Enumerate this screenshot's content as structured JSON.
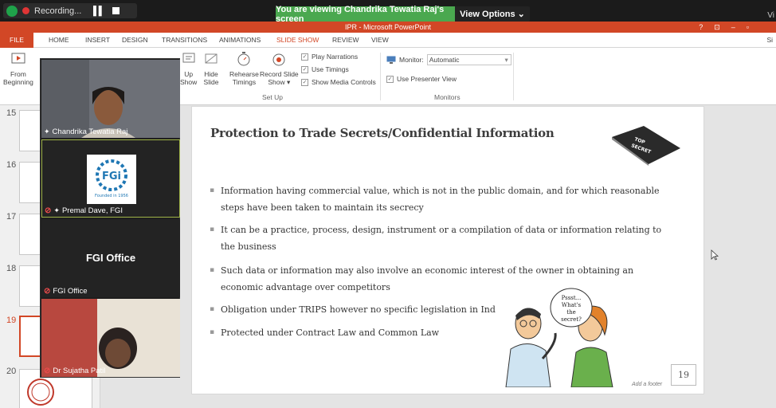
{
  "zoom": {
    "recording_label": "Recording...",
    "viewing_banner": "You are viewing Chandrika Tewatia Raj's screen",
    "view_options": "View Options ⌄",
    "top_right": "Vi"
  },
  "window": {
    "title": "IPR - Microsoft PowerPoint",
    "help": "?",
    "controls": [
      "?",
      "⊡",
      "–",
      "▫"
    ]
  },
  "ribbon_tabs": [
    "FILE",
    "HOME",
    "INSERT",
    "DESIGN",
    "TRANSITIONS",
    "ANIMATIONS",
    "SLIDE SHOW",
    "REVIEW",
    "VIEW"
  ],
  "active_tab": "SLIDE SHOW",
  "sign_in": "Si",
  "ribbon": {
    "from_beginning": [
      "From",
      "Beginning"
    ],
    "set_up_show": [
      "Up",
      "Show"
    ],
    "hide_slide": [
      "Hide",
      "Slide"
    ],
    "rehearse_timings": [
      "Rehearse",
      "Timings"
    ],
    "record_slide_show": [
      "Record Slide",
      "Show ▾"
    ],
    "play_narrations": "Play Narrations",
    "use_timings": "Use Timings",
    "show_media_controls": "Show Media Controls",
    "setup_group": "Set Up",
    "monitor_label": "Monitor:",
    "monitor_value": "Automatic",
    "use_presenter_view": "Use Presenter View",
    "monitors_group": "Monitors"
  },
  "thumbnails": {
    "numbers": [
      "15",
      "16",
      "17",
      "18",
      "19",
      "20"
    ],
    "selected": "19"
  },
  "slide": {
    "title": "Protection to Trade Secrets/Confidential Information",
    "bullets": [
      "Information having commercial value, which is not in the public domain, and for which reasonable steps have been taken to maintain its secrecy",
      "It can be a practice, process, design, instrument or a compilation of data or information relating to the business",
      "Such data or information may also involve an economic interest of the owner in obtaining an economic advantage over competitors",
      "Obligation under TRIPS however no specific legislation in Ind",
      "Protected under Contract Law and Common Law"
    ],
    "book_text": [
      "TOP",
      "SECRET"
    ],
    "speech_bubble": [
      "Pssst...",
      "What's",
      "the",
      "secret?"
    ],
    "footer": "Add a footer",
    "page_number": "19"
  },
  "participants": [
    {
      "name": "Chandrika Tewatia Raj"
    },
    {
      "name": "Premal Dave, FGI",
      "logo_text": "FGi",
      "logo_sub": "Founded in 1956"
    },
    {
      "name": "FGI Office",
      "center_text": "FGI Office"
    },
    {
      "name": "Dr Sujatha Patil"
    }
  ],
  "colors": {
    "powerpoint_accent": "#d24726",
    "zoom_green": "#4aa84f",
    "muted_mic": "#e84b4b"
  }
}
